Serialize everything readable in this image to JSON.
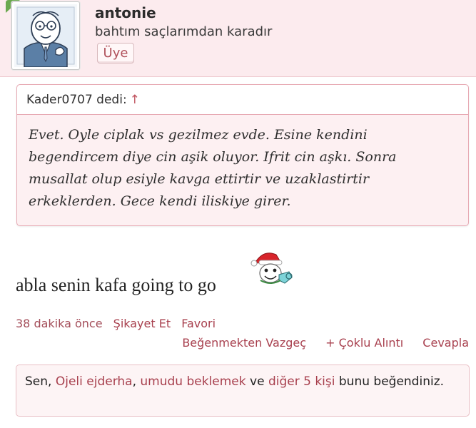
{
  "user": {
    "name": "antonie",
    "title": "bahtım saçlarımdan karadır",
    "rank": "Üye"
  },
  "quote": {
    "author": "Kader0707 dedi:",
    "arrow": "↑",
    "text": "Evet. Oyle ciplak vs gezilmez evde. Esine kendini begendircem diye cin aşik oluyor. Ifrit cin aşkı. Sonra musallat olup esiyle kavga ettirtir ve uzaklastirtir erkeklerden. Gece kendi iliskiye girer."
  },
  "post": {
    "text": "abla senin kafa going to go"
  },
  "meta": {
    "time": "38 dakika önce",
    "report": "Şikayet Et",
    "favorite": "Favori"
  },
  "actions": {
    "unlike": "Beğenmekten Vazgeç",
    "multi_quote": "+ Çoklu Alıntı",
    "reply": "Cevapla"
  },
  "likes": {
    "prefix": "Sen,",
    "user1": "Ojeli ejderha",
    "sep": ",",
    "user2": "umudu beklemek",
    "and": "ve",
    "others": "diğer 5 kişi",
    "suffix": "bunu beğendiniz."
  },
  "colors": {
    "accent": "#a8404e",
    "header_bg": "#fcebee",
    "quote_border": "#e7a9b3"
  }
}
